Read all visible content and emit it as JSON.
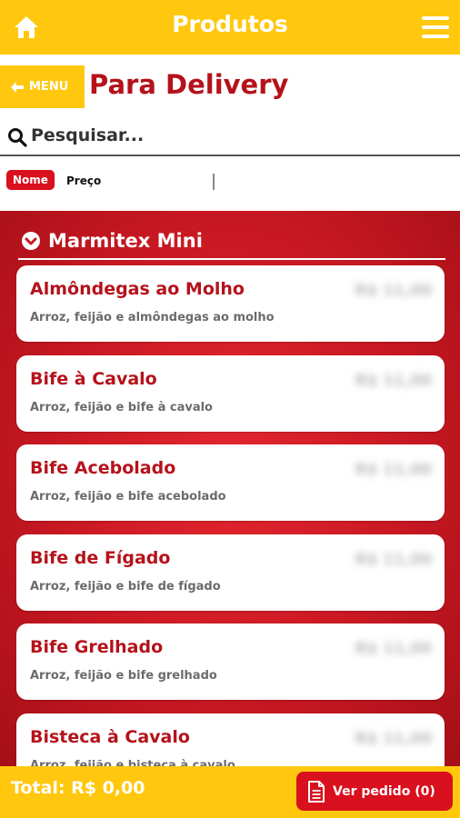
{
  "header": {
    "title": "Produtos",
    "home_icon": "home-icon",
    "menu_icon": "hamburger-menu-icon"
  },
  "menu_button": {
    "label": "MENU",
    "icon": "arrow-left-icon"
  },
  "page_title": "Para Delivery",
  "search": {
    "placeholder": "Pesquisar...",
    "value": "",
    "icon": "search-icon"
  },
  "sort": {
    "options": [
      "Nome",
      "Preço"
    ],
    "active": "Nome"
  },
  "category": {
    "name": "Marmitex Mini",
    "icon": "chevron-down-circle-icon"
  },
  "products": [
    {
      "name": "Almôndegas ao Molho",
      "description": "Arroz, feijão e almôndegas ao molho",
      "price": "R$ 11,00"
    },
    {
      "name": "Bife à Cavalo",
      "description": "Arroz, feijão e bife à cavalo",
      "price": "R$ 11,00"
    },
    {
      "name": "Bife Acebolado",
      "description": "Arroz, feijão e bife acebolado",
      "price": "R$ 11,00"
    },
    {
      "name": "Bife de Fígado",
      "description": "Arroz, feijão e bife de fígado",
      "price": "R$ 11,00"
    },
    {
      "name": "Bife Grelhado",
      "description": "Arroz, feijão e bife grelhado",
      "price": "R$ 11,00"
    },
    {
      "name": "Bisteca à Cavalo",
      "description": "Arroz, feijão e bisteca à cavalo",
      "price": "R$ 11,00"
    }
  ],
  "footer": {
    "total": "Total: R$ 0,00",
    "order_button": "Ver pedido (0)",
    "order_icon": "document-icon"
  },
  "colors": {
    "primary_yellow": "#ffc80e",
    "primary_red": "#d9101d",
    "title_red": "#b5121b"
  }
}
